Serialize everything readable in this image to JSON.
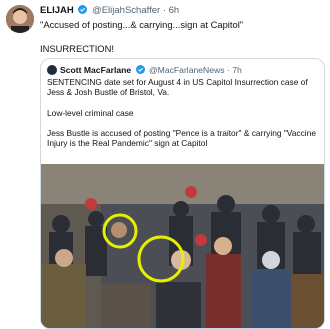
{
  "tweet": {
    "display_name": "ELIJAH",
    "handle": "@ElijahSchaffer",
    "separator": "·",
    "time": "6h",
    "text": "\"Accused of posting...& carrying...sign at Capitol\"\n\nINSURRECTION!"
  },
  "quoted": {
    "display_name": "Scott MacFarlane",
    "handle": "@MacFarlaneNews",
    "separator": "·",
    "time": "7h",
    "text": "SENTENCING date set for August 4 in US Capitol Insurrection case of Jess & Josh Bustle of Bristol, Va.\n\nLow-level criminal case\n\nJess Bustle is accused of posting \"Pence is a traitor\" & carrying \"Vaccine Injury is the Real Pandemic\" sign at Capitol"
  },
  "colors": {
    "verified": "#1d9bf0",
    "highlight_circle": "#e5f000",
    "muted_text": "#536471",
    "border": "#cfd9de"
  }
}
